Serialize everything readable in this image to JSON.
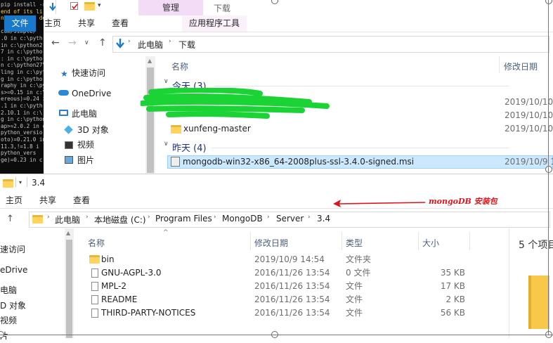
{
  "terminal": {
    "lines": [
      {
        "text": "pip install -r",
        "yellow": false
      },
      {
        "text": "end of its li",
        "yellow": true
      },
      {
        "text": "n 2.7. More de",
        "yellow": true
      },
      {
        "text": "",
        "yellow": false
      },
      {
        "text": "com/simple/",
        "yellow": false
      },
      {
        "text": ".0 in c:\\pyth",
        "yellow": false
      },
      {
        "text": "in c:\\python2",
        "yellow": false
      },
      {
        "text": "7 in c:\\pytho",
        "yellow": false
      },
      {
        "text": ": in c:\\pytho",
        "yellow": false
      },
      {
        "text": "n c:\\python27\\l",
        "yellow": false
      },
      {
        "text": "ling in c:\\pyt",
        "yellow": false
      },
      {
        "text": "g in c:\\pytho",
        "yellow": false
      },
      {
        "text": "raphy in c:\\py",
        "yellow": false
      },
      {
        "text": "s>=0.15 in c:\\",
        "yellow": false
      },
      {
        "text": "ereous)=0.24 in",
        "yellow": false
      },
      {
        "text": ".1 in c:\\pyth",
        "yellow": false
      },
      {
        "text": "2.10.1 in c:\\",
        "yellow": false
      },
      {
        "text": "g in c:\\python2",
        "yellow": false
      },
      {
        "text": "ap>=2.0.2 in c",
        "yellow": false
      },
      {
        "text": "python_versio",
        "yellow": false
      },
      {
        "text": "oto)=0.21.0 in",
        "yellow": false
      },
      {
        "text": "11.3,!=1.8 i",
        "yellow": false
      },
      {
        "text": "python_vers",
        "yellow": false
      },
      {
        "text": "ge)=0.23 in c",
        "yellow": false
      }
    ]
  },
  "top_window": {
    "manage_tab": "管理",
    "title": "下载",
    "ribbon_tabs": [
      "文件",
      "主页",
      "共享",
      "查看"
    ],
    "app_tools_tab": "应用程序工具",
    "breadcrumb": [
      "此电脑",
      "下载"
    ],
    "nav_items": [
      "快速访问",
      "OneDrive",
      "此电脑",
      "3D 对象",
      "视频",
      "图片"
    ],
    "col_name": "名称",
    "col_date": "修改日期",
    "group_today": "今天 (3)",
    "group_yesterday": "昨天 (4)",
    "rows": [
      {
        "name": "",
        "date": "2019/10/10"
      },
      {
        "name": "",
        "date": "2019/10/10"
      },
      {
        "name": "xunfeng-master",
        "date": "2019/10/10"
      }
    ],
    "selected_row": {
      "name": "mongodb-win32-x86_64-2008plus-ssl-3.4.0-signed.msi",
      "date": "2019/10/9 1..."
    }
  },
  "bottom_window": {
    "title": "3.4",
    "ribbon_tabs": [
      "主页",
      "共享",
      "查看"
    ],
    "breadcrumb": [
      "此电脑",
      "本地磁盘 (C:)",
      "Program Files",
      "MongoDB",
      "Server",
      "3.4"
    ],
    "nav_items": [
      "速访问",
      "eDrive",
      "电脑",
      "D 对象",
      "视频",
      "片"
    ],
    "columns": {
      "name": "名称",
      "date": "修改日期",
      "type": "类型",
      "size": "大小"
    },
    "rows": [
      {
        "name": "bin",
        "date": "2019/10/9 14:54",
        "type": "文件夹",
        "size": "",
        "kind": "folder"
      },
      {
        "name": "GNU-AGPL-3.0",
        "date": "2016/11/26 13:54",
        "type": "0 文件",
        "size": "35 KB",
        "kind": "file"
      },
      {
        "name": "MPL-2",
        "date": "2016/11/26 13:54",
        "type": "文件",
        "size": "17 KB",
        "kind": "file"
      },
      {
        "name": "README",
        "date": "2016/11/26 13:54",
        "type": "文件",
        "size": "2 KB",
        "kind": "file"
      },
      {
        "name": "THIRD-PARTY-NOTICES",
        "date": "2016/11/26 13:54",
        "type": "文件",
        "size": "56 KB",
        "kind": "file"
      }
    ],
    "item_count": "5 个项目"
  },
  "annotation": {
    "text": "mongoDB 安装包",
    "color": "#e0141c"
  }
}
